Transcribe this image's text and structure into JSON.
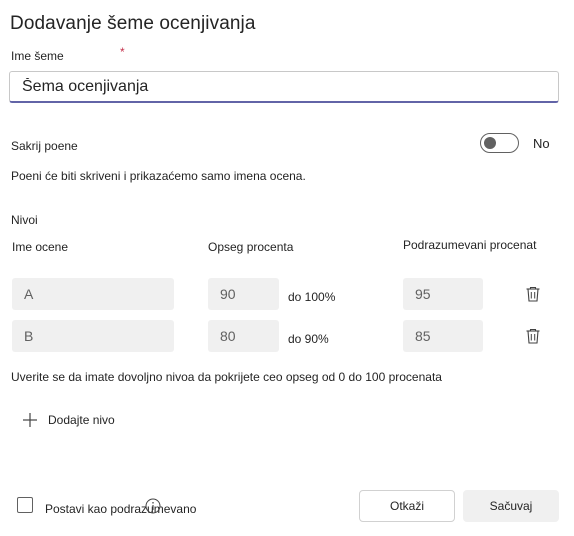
{
  "dialog": {
    "title": "Dodavanje šeme ocenjivanja",
    "name_label": "Ime šeme",
    "required_mark": "*",
    "name_value": "Šema ocenjivanja"
  },
  "hide_points": {
    "label": "Sakrij poene",
    "toggle_state": "No",
    "description": "Poeni će biti skriveni i prikazaćemo samo imena ocena."
  },
  "levels": {
    "section_label": "Nivoi",
    "columns": {
      "grade_name": "Ime ocene",
      "percent_range": "Opseg procenta",
      "default_percent": "Podrazumevani procenat"
    },
    "rows": [
      {
        "name": "A",
        "from": "90",
        "to": "do 100%",
        "default": "95"
      },
      {
        "name": "B",
        "from": "80",
        "to": "do 90%",
        "default": "85"
      }
    ],
    "hint": "Uverite se da imate dovoljno nivoa da pokrijete ceo opseg od 0 do 100 procenata",
    "add_label": "Dodajte nivo"
  },
  "footer": {
    "set_default_label": "Postavi kao podrazumevano",
    "cancel_label": "Otkaži",
    "save_label": "Sačuvaj"
  },
  "colors": {
    "accent": "#6264a7",
    "required": "#c4314b",
    "field_bg": "#f0f0f0"
  }
}
